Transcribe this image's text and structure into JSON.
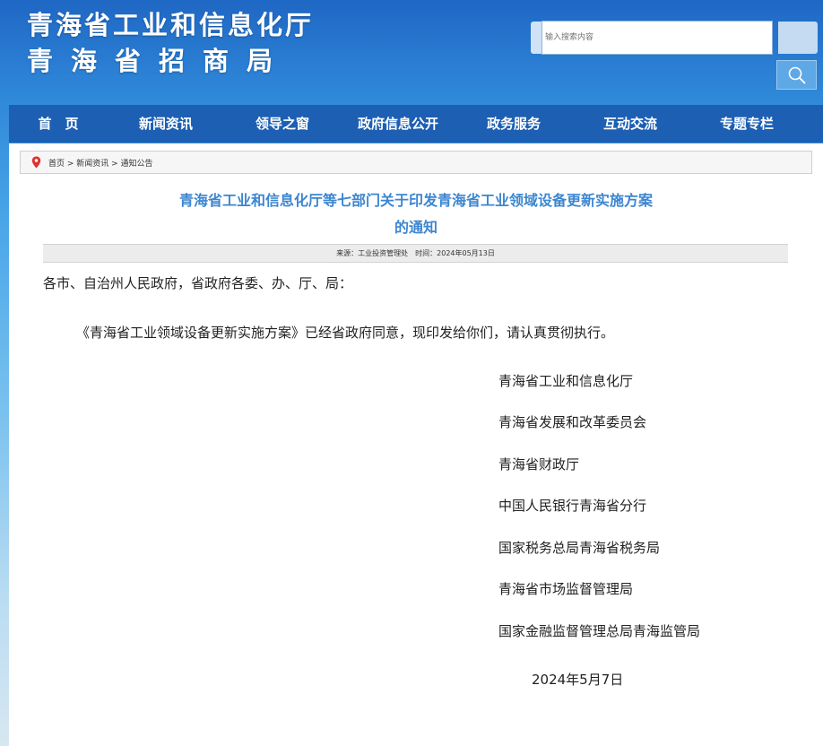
{
  "header": {
    "title_line1": "青海省工业和信息化厅",
    "title_line2": "青海省招商局",
    "search_placeholder": "输入搜索内容"
  },
  "nav": {
    "items": [
      "首　页",
      "新闻资讯",
      "领导之窗",
      "政府信息公开",
      "政务服务",
      "互动交流",
      "专题专栏"
    ]
  },
  "breadcrumb": {
    "text": "首页 > 新闻资讯 > 通知公告"
  },
  "article": {
    "title_line1": "青海省工业和信息化厅等七部门关于印发青海省工业领域设备更新实施方案",
    "title_line2": "的通知",
    "meta": "来源：工业投资管理处　时间：2024年05月13日",
    "salutation": "各市、自治州人民政府，省政府各委、办、厅、局：",
    "body": "《青海省工业领域设备更新实施方案》已经省政府同意，现印发给你们，请认真贯彻执行。",
    "signatories": [
      "青海省工业和信息化厅",
      "青海省发展和改革委员会",
      "青海省财政厅",
      "中国人民银行青海省分行",
      "国家税务总局青海省税务局",
      "青海省市场监督管理局",
      "国家金融监督管理总局青海监管局"
    ],
    "date": "2024年5月7日"
  },
  "colors": {
    "nav_bg": "#1d5fb3",
    "title_blue": "#3c86d0",
    "location_pin": "#e0312d"
  },
  "icons": {
    "search": "magnifier-icon",
    "location": "location-pin-icon"
  }
}
